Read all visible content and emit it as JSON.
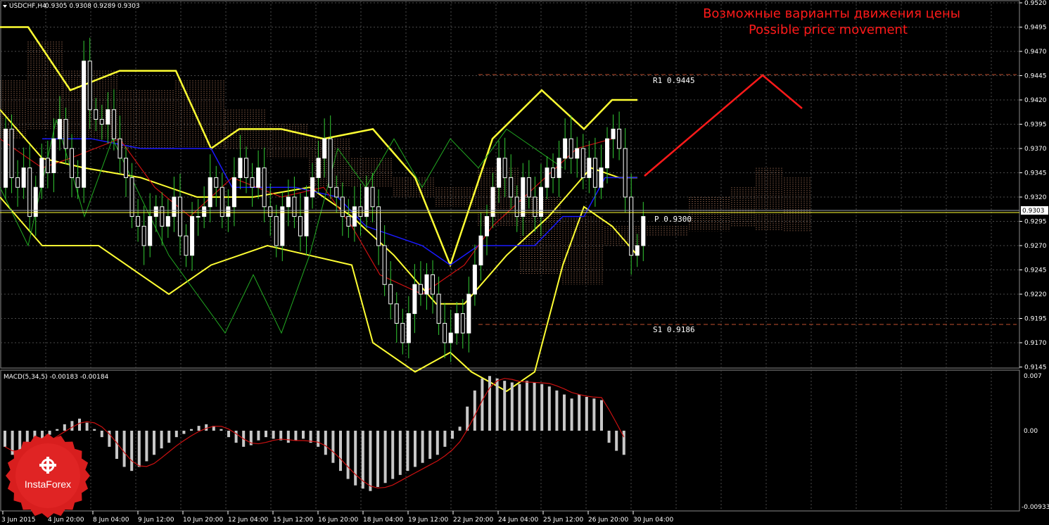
{
  "header": {
    "symbol": "USDCHF,H4",
    "ohlc": "0.9305 0.9308 0.9289 0.9303",
    "indicator": "MACD(5,34,5) -0.00183 -0.00184"
  },
  "annotation": {
    "ru": "Возможные варианты движения цены",
    "en": "Possible price movement"
  },
  "levels": {
    "r1": "R1  0.9445",
    "p": "P  0.9300",
    "s1": "S1  0.9186"
  },
  "price_axis": {
    "labels": [
      "0.9520",
      "0.9495",
      "0.9470",
      "0.9445",
      "0.9420",
      "0.9395",
      "0.9370",
      "0.9345",
      "0.9320",
      "0.9295",
      "0.9270",
      "0.9245",
      "0.9220",
      "0.9195",
      "0.9170",
      "0.9145"
    ],
    "current": "0.9303"
  },
  "macd_axis": {
    "top": "0.007",
    "zero": "0.00",
    "bottom": "-0.00933"
  },
  "time_axis": [
    "3 Jun 2015",
    "4 Jun 20:00",
    "8 Jun 04:00",
    "9 Jun 12:00",
    "10 Jun 20:00",
    "12 Jun 04:00",
    "15 Jun 12:00",
    "16 Jun 20:00",
    "18 Jun 04:00",
    "19 Jun 12:00",
    "22 Jun 20:00",
    "24 Jun 04:00",
    "25 Jun 12:00",
    "26 Jun 20:00",
    "30 Jun 04:00"
  ],
  "logo": {
    "text": "InstaForex"
  },
  "colors": {
    "background": "#000000",
    "grid": "#5a5a5a",
    "bull": "#ffffff",
    "bear": "#ffffff",
    "bollinger": "#ffff33",
    "kijun": "#1a1aff",
    "tenkan": "#cc1111",
    "chikou": "#22aa22",
    "cloud": "#c98a6a",
    "annotation": "#ff1a1a"
  }
}
